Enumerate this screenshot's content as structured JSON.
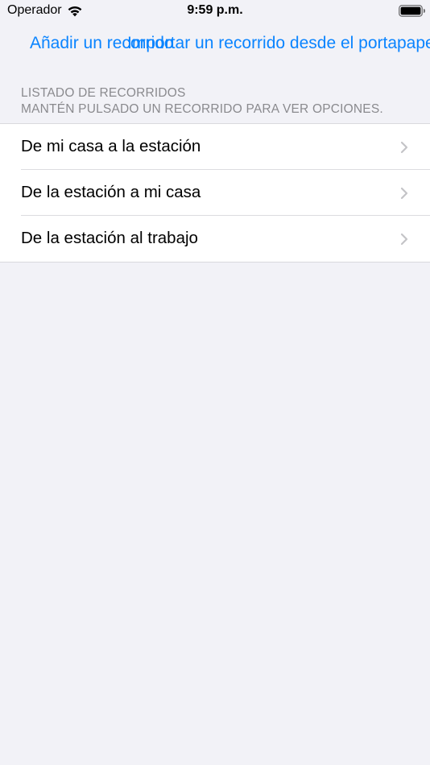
{
  "status_bar": {
    "carrier": "Operador",
    "time": "9:59 p.m."
  },
  "nav": {
    "add_route_label": "Añadir un recorrido",
    "import_route_label": "Importar un recorrido desde el portapapeles"
  },
  "section": {
    "title": "LISTADO DE RECORRIDOS",
    "hint": "MANTÉN PULSADO UN RECORRIDO PARA VER OPCIONES."
  },
  "routes": [
    {
      "label": "De mi casa a la estación"
    },
    {
      "label": "De la estación a mi casa"
    },
    {
      "label": "De la estación al trabajo"
    }
  ],
  "icons": {
    "signal": "wifi-icon",
    "battery": "battery-icon",
    "disclosure": "chevron-right-icon"
  },
  "colors": {
    "accent": "#0a84ff",
    "background": "#f2f2f7",
    "secondary_text": "#8a8a8e"
  }
}
